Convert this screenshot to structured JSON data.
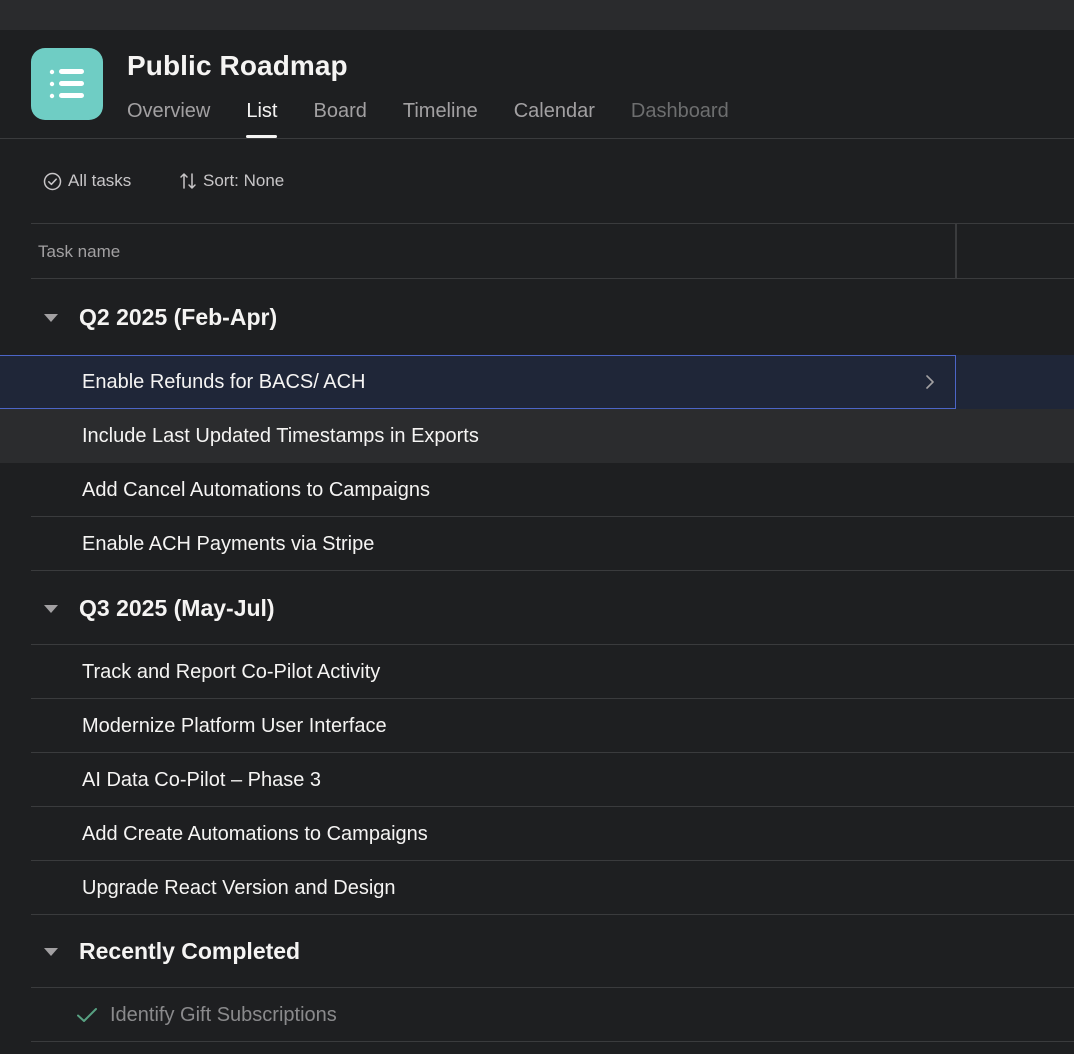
{
  "header": {
    "title": "Public Roadmap",
    "app_icon": "list-icon",
    "accent_color": "#6fcdc4"
  },
  "tabs": [
    {
      "label": "Overview",
      "active": false
    },
    {
      "label": "List",
      "active": true
    },
    {
      "label": "Board",
      "active": false
    },
    {
      "label": "Timeline",
      "active": false
    },
    {
      "label": "Calendar",
      "active": false
    },
    {
      "label": "Dashboard",
      "active": false
    }
  ],
  "toolbar": {
    "filter_label": "All tasks",
    "filter_icon": "check-circle-icon",
    "sort_label": "Sort: None",
    "sort_icon": "sort-arrows-icon"
  },
  "table": {
    "column_task_name": "Task name"
  },
  "sections": [
    {
      "title": "Q2 2025 (Feb-Apr)",
      "tasks": [
        {
          "name": "Enable Refunds for BACS/ ACH",
          "state": "selected"
        },
        {
          "name": "Include Last Updated Timestamps in Exports",
          "state": "hover"
        },
        {
          "name": "Add Cancel Automations to Campaigns",
          "state": "normal"
        },
        {
          "name": "Enable ACH Payments via Stripe",
          "state": "normal"
        }
      ]
    },
    {
      "title": "Q3 2025 (May-Jul)",
      "tasks": [
        {
          "name": "Track and Report Co-Pilot Activity",
          "state": "normal"
        },
        {
          "name": "Modernize Platform User Interface",
          "state": "normal"
        },
        {
          "name": "AI Data Co-Pilot – Phase 3",
          "state": "normal"
        },
        {
          "name": "Add Create Automations to Campaigns",
          "state": "normal"
        },
        {
          "name": "Upgrade React Version and Design",
          "state": "normal"
        }
      ]
    },
    {
      "title": "Recently Completed",
      "tasks": [
        {
          "name": "Identify Gift Subscriptions",
          "state": "completed"
        }
      ]
    }
  ]
}
